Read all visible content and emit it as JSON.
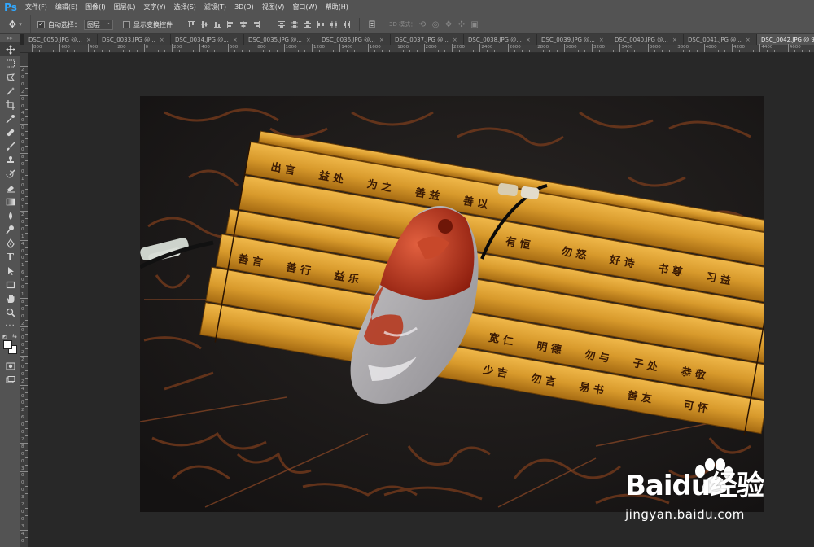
{
  "app": {
    "logo": "Ps"
  },
  "menu": [
    "文件(F)",
    "编辑(E)",
    "图像(I)",
    "图层(L)",
    "文字(Y)",
    "选择(S)",
    "滤镜(T)",
    "3D(D)",
    "视图(V)",
    "窗口(W)",
    "帮助(H)"
  ],
  "options": {
    "auto_select_label": "自动选择：",
    "auto_select_checked": true,
    "auto_select_target": "图层",
    "show_transform_label": "显示变换控件",
    "show_transform_checked": false,
    "mode3d_label": "3D 模式："
  },
  "tabs": [
    {
      "label": "DSC_0050.JPG @...",
      "active": false
    },
    {
      "label": "DSC_0033.JPG @...",
      "active": false
    },
    {
      "label": "DSC_0034.JPG @...",
      "active": false
    },
    {
      "label": "DSC_0035.JPG @...",
      "active": false
    },
    {
      "label": "DSC_0036.JPG @...",
      "active": false
    },
    {
      "label": "DSC_0037.JPG @...",
      "active": false
    },
    {
      "label": "DSC_0038.JPG @...",
      "active": false
    },
    {
      "label": "DSC_0039.JPG @...",
      "active": false
    },
    {
      "label": "DSC_0040.JPG @...",
      "active": false
    },
    {
      "label": "DSC_0041.JPG @...",
      "active": false
    },
    {
      "label": "DSC_0042.JPG @ 9...",
      "active": true
    }
  ],
  "ruler_h": [
    "800",
    "600",
    "400",
    "200",
    "0",
    "200",
    "400",
    "600",
    "800",
    "1000",
    "1200",
    "1400",
    "1600",
    "1800",
    "2000",
    "2200",
    "2400",
    "2600",
    "2800",
    "3000",
    "3200",
    "3400",
    "3600",
    "3800",
    "4000",
    "4200",
    "4400",
    "4600"
  ],
  "ruler_v": [
    "2",
    "0",
    "0",
    "2",
    "0",
    "0",
    "4",
    "0",
    "0",
    "6",
    "0",
    "0",
    "8",
    "0",
    "0",
    "1",
    "0",
    "0",
    "0",
    "1",
    "2",
    "0",
    "0",
    "1",
    "4",
    "0",
    "0",
    "1",
    "6",
    "0",
    "0",
    "1",
    "8",
    "0",
    "0",
    "2",
    "0",
    "0",
    "0",
    "2",
    "2",
    "0",
    "0",
    "2",
    "4",
    "0",
    "0",
    "2",
    "6",
    "0",
    "0",
    "2",
    "8",
    "0",
    "0",
    "3",
    "0",
    "0",
    "0",
    "3",
    "2",
    "0",
    "0",
    "3",
    "4",
    "0",
    "0"
  ],
  "colors": {
    "foreground": "#ffffff",
    "background": "#ffffff",
    "ps_blue": "#31a8ff"
  },
  "watermark": {
    "brand": "Baidu经验",
    "url": "jingyan.baidu.com"
  }
}
